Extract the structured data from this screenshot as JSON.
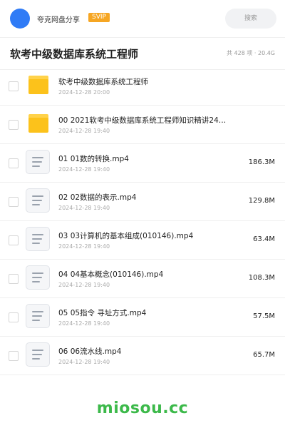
{
  "header": {
    "username": "夸克网盘分享",
    "badge": "SVIP",
    "search_placeholder": "搜索",
    "avatar_color": "#2f7bf6",
    "badge_color": "#f6a623"
  },
  "page": {
    "title": "软考中级数据库系统工程师",
    "summary": "共 428 项 · 20.4G"
  },
  "files": [
    {
      "type": "folder",
      "name": "软考中级数据库系统工程师",
      "date": "2024-12-28 20:00",
      "size": ""
    },
    {
      "type": "folder",
      "name": "00 2021软考中级数据库系统工程师知识精讲24…",
      "date": "2024-12-28 19:40",
      "size": ""
    },
    {
      "type": "video",
      "name": "01 01数的转换.mp4",
      "date": "2024-12-28 19:40",
      "size": "186.3M"
    },
    {
      "type": "video",
      "name": "02 02数据的表示.mp4",
      "date": "2024-12-28 19:40",
      "size": "129.8M"
    },
    {
      "type": "video",
      "name": "03 03计算机的基本组成(010146).mp4",
      "date": "2024-12-28 19:40",
      "size": "63.4M"
    },
    {
      "type": "video",
      "name": "04 04基本概念(010146).mp4",
      "date": "2024-12-28 19:40",
      "size": "108.3M"
    },
    {
      "type": "video",
      "name": "05 05指令 寻址方式.mp4",
      "date": "2024-12-28 19:40",
      "size": "57.5M"
    },
    {
      "type": "video",
      "name": "06 06流水线.mp4",
      "date": "2024-12-28 19:40",
      "size": "65.7M"
    }
  ],
  "footer": {
    "brand": "miosou.cc",
    "brand_color": "#3cb94a"
  }
}
